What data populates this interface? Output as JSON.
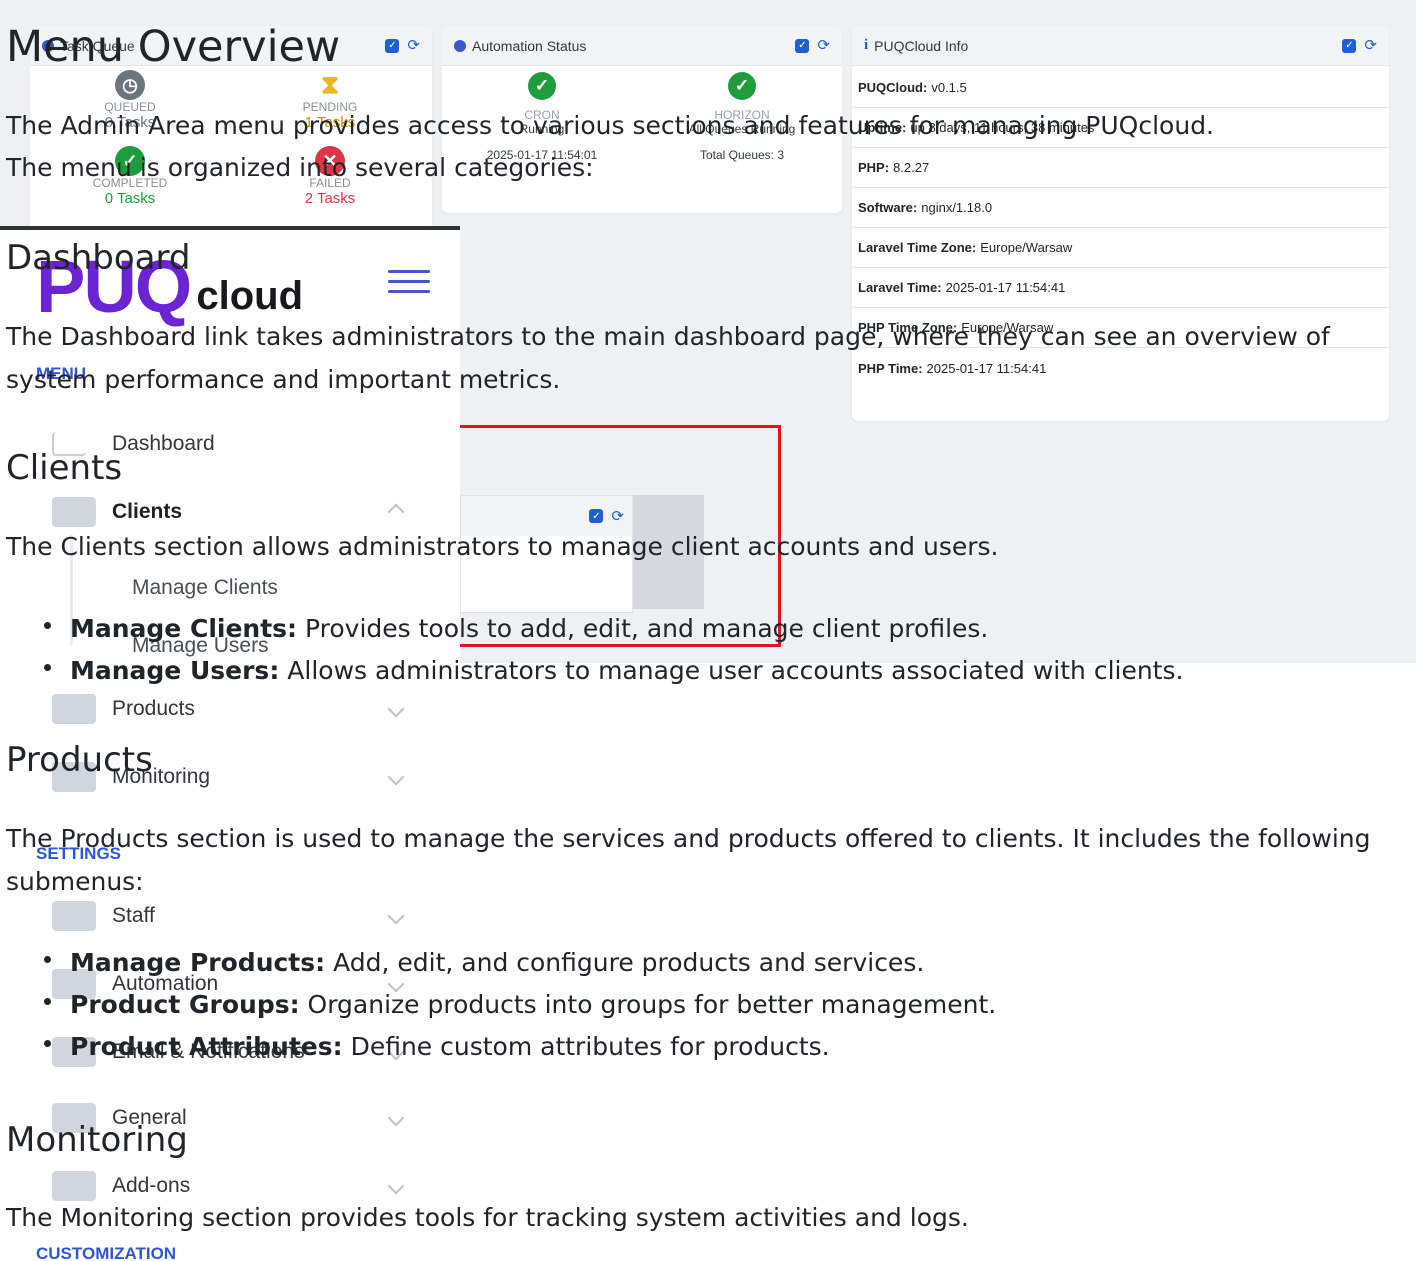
{
  "screenshot": {
    "task_queue": {
      "title": "Task Queue",
      "cells": [
        {
          "label": "QUEUED",
          "value": "0 Tasks",
          "color": "#6c757d"
        },
        {
          "label": "PENDING",
          "value": "1 Tasks",
          "color": "#f0b429"
        },
        {
          "label": "COMPLETED",
          "value": "0 Tasks",
          "color": "#1f9d3c"
        },
        {
          "label": "FAILED",
          "value": "2 Tasks",
          "color": "#dc3545"
        }
      ]
    },
    "automation_status": {
      "title": "Automation Status",
      "cron_label": "CRON",
      "cron_status": "Running",
      "cron_time": "2025-01-17 11:54:01",
      "horizon_label": "HORIZON",
      "horizon_status": "All Queues Running",
      "horizon_queues": "Total Queues: 3"
    },
    "puqcloud_info": {
      "title": "PUQCloud Info",
      "rows": [
        {
          "key": "PUQCloud:",
          "value": "v0.1.5"
        },
        {
          "key": "Uptime:",
          "value": "up 8 days, 11 hours, 38 minutes"
        },
        {
          "key": "PHP:",
          "value": "8.2.27"
        },
        {
          "key": "Software:",
          "value": "nginx/1.18.0"
        },
        {
          "key": "Laravel Time Zone:",
          "value": "Europe/Warsaw"
        },
        {
          "key": "Laravel Time:",
          "value": "2025-01-17 11:54:41"
        },
        {
          "key": "PHP Time Zone:",
          "value": "Europe/Warsaw"
        },
        {
          "key": "PHP Time:",
          "value": "2025-01-17 11:54:41"
        }
      ]
    },
    "sidebar": {
      "logo_puq": "PUQ",
      "logo_cloud": "cloud",
      "menu_section": "MENU",
      "settings_section": "SETTINGS",
      "customization_section": "CUSTOMIZATION",
      "dashboard": "Dashboard",
      "clients": "Clients",
      "manage_clients": "Manage Clients",
      "manage_users": "Manage Users",
      "products": "Products",
      "monitoring": "Monitoring",
      "staff": "Staff",
      "automation": "Automation",
      "email_notifications": "Email & Notifications",
      "general": "General",
      "addons": "Add-ons"
    },
    "accent_red": "#e3151a",
    "accent_blue": "#2f55d4"
  },
  "doc": {
    "title": "Menu Overview",
    "intro_1": "The Admin Area menu provides access to various sections and features for managing PUQcloud.",
    "intro_2": "The menu is organized into several categories:",
    "dashboard_heading": "Dashboard",
    "dashboard_text": "The Dashboard link takes administrators to the main dashboard page, where they can see an overview of system performance and important metrics.",
    "clients_heading": "Clients",
    "clients_text": "The Clients section allows administrators to manage client accounts and users.",
    "clients_items": [
      {
        "term": "Manage Clients:",
        "desc": " Provides tools to add, edit, and manage client profiles."
      },
      {
        "term": "Manage Users:",
        "desc": " Allows administrators to manage user accounts associated with clients."
      }
    ],
    "products_heading": "Products",
    "products_text": "The Products section is used to manage the services and products offered to clients. It includes the following submenus:",
    "products_items": [
      {
        "term": "Manage Products:",
        "desc": " Add, edit, and configure products and services."
      },
      {
        "term": "Product Groups:",
        "desc": " Organize products into groups for better management."
      },
      {
        "term": "Product Attributes:",
        "desc": " Define custom attributes for products."
      }
    ],
    "monitoring_heading": "Monitoring",
    "monitoring_text": "The Monitoring section provides tools for tracking system activities and logs."
  }
}
